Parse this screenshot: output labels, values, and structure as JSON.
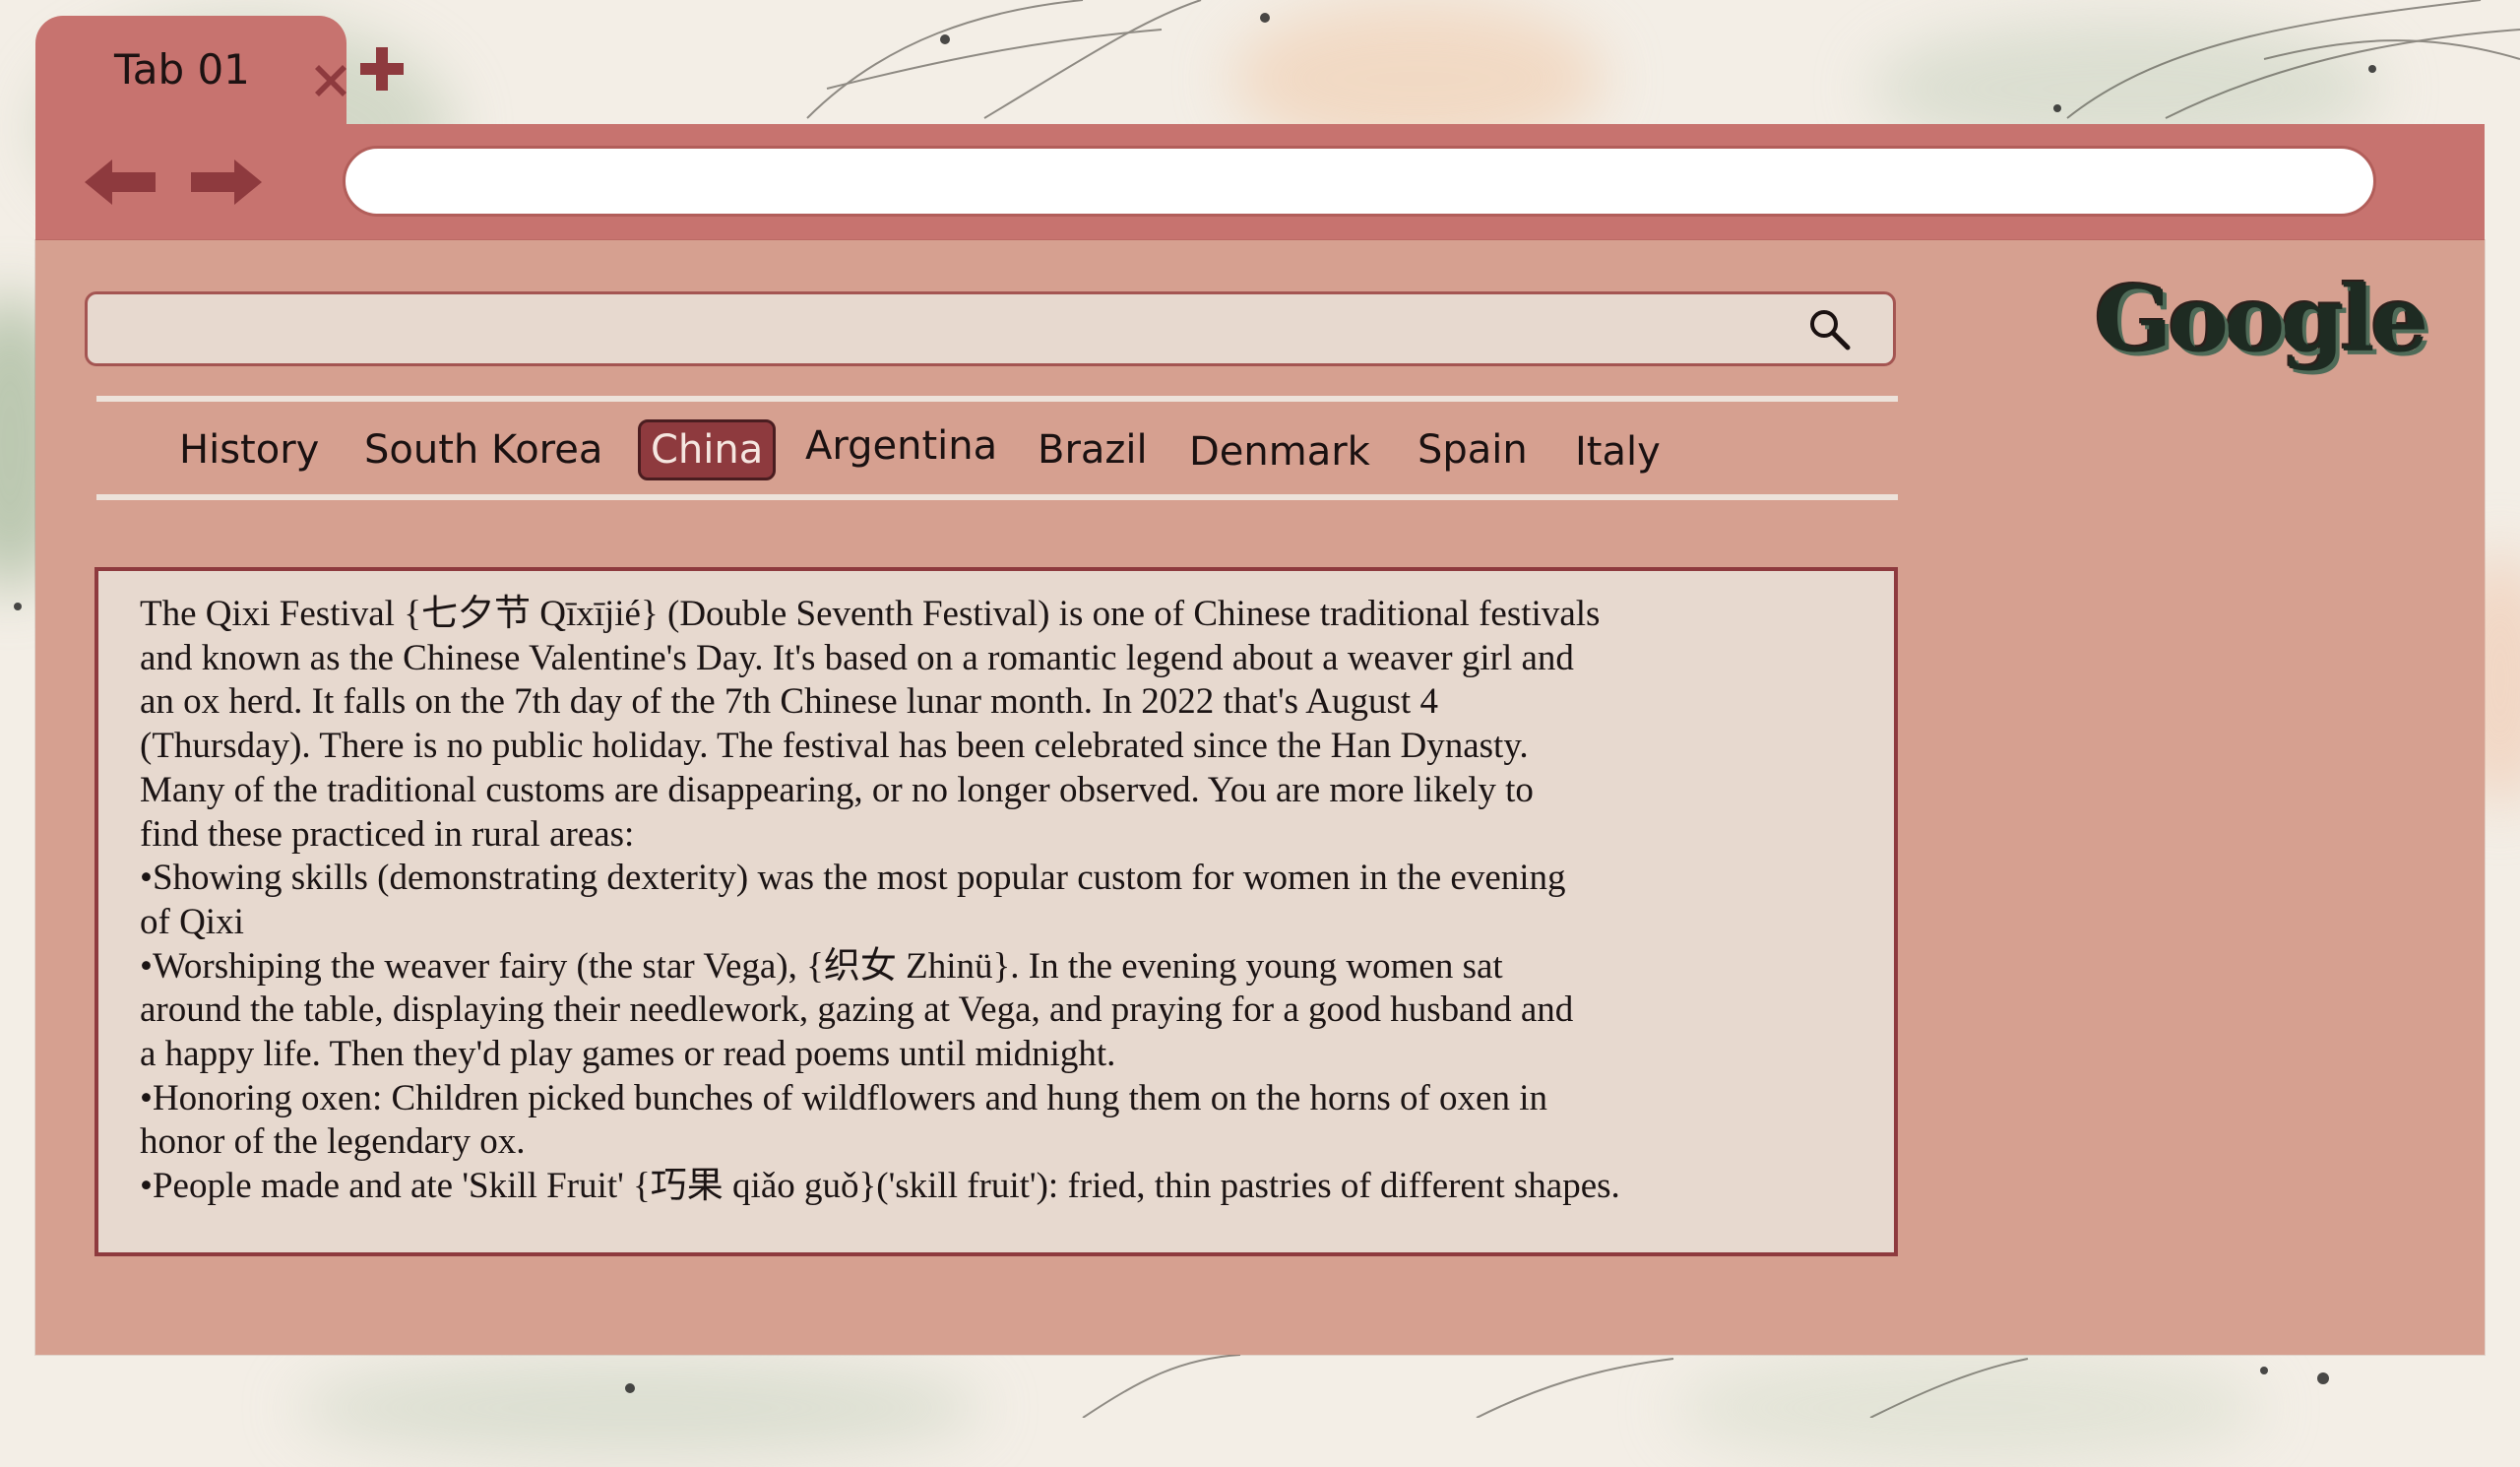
{
  "tab": {
    "title": "Tab 01"
  },
  "address_bar": {
    "value": ""
  },
  "search": {
    "value": ""
  },
  "logo": {
    "text": "Google"
  },
  "nav_tabs": [
    {
      "label": "History"
    },
    {
      "label": "South Korea"
    },
    {
      "label": "China",
      "active": true
    },
    {
      "label": "Argentina"
    },
    {
      "label": "Brazil"
    },
    {
      "label": "Denmark"
    },
    {
      "label": "Spain"
    },
    {
      "label": "Italy"
    }
  ],
  "content": {
    "lines": [
      "The Qixi Festival {七夕节 Qīxījié} (Double Seventh Festival) is one of Chinese traditional festivals",
      "and known as the Chinese Valentine's Day. It's based on a romantic legend about a weaver girl and",
      "an ox herd. It falls on the 7th day of the 7th Chinese lunar month. In 2022 that's August 4",
      "(Thursday). There is no public holiday. The festival has been celebrated since the Han Dynasty.",
      "Many of the traditional customs are disappearing, or no longer observed. You are more likely to",
      "find these practiced in rural areas:",
      "•Showing skills (demonstrating dexterity) was the most popular custom for women in the evening",
      "of Qixi",
      "•Worshiping the weaver fairy (the star Vega), {织女 Zhinü}. In the evening young women sat",
      "around the table, displaying their needlework, gazing at Vega, and praying for a good husband and",
      "a happy life. Then they'd play games or read poems until midnight.",
      "•Honoring oxen: Children picked bunches of wildflowers and hung them on the horns of oxen in",
      "honor of the legendary ox.",
      "•People made and ate 'Skill Fruit' {巧果 qiǎo guǒ}('skill fruit'): fried, thin pastries of different shapes."
    ]
  },
  "icons": {
    "close": "close-icon",
    "add": "plus-icon",
    "back": "arrow-left-icon",
    "forward": "arrow-right-icon",
    "search": "search-icon"
  },
  "colors": {
    "frame": "#c7736f",
    "panel": "#d6a090",
    "content_bg": "#e7d9cf",
    "active_tab": "#8e3a3e"
  }
}
